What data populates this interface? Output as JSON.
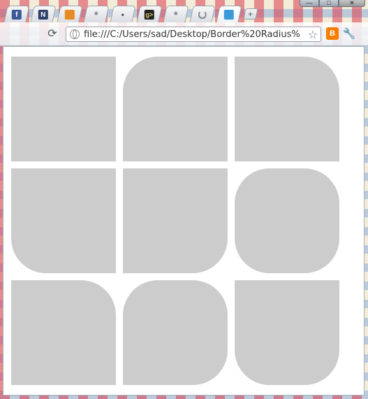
{
  "browser": {
    "address_bar": {
      "url": "file:///C:/Users/sad/Desktop/Border%20Radius%"
    },
    "tabs": [
      {
        "icon": "facebook-icon",
        "glyph": "f"
      },
      {
        "icon": "notepad-icon",
        "glyph": "N"
      },
      {
        "icon": "image-icon",
        "glyph": ""
      },
      {
        "icon": "asterisk-icon",
        "glyph": "*"
      },
      {
        "icon": "dot-icon",
        "glyph": "•"
      },
      {
        "icon": "terminal-icon",
        "glyph": "g>"
      },
      {
        "icon": "asterisk-icon",
        "glyph": "*"
      },
      {
        "icon": "loading-icon",
        "glyph": ""
      },
      {
        "icon": "ask-icon",
        "glyph": ""
      }
    ],
    "new_tab_glyph": "+",
    "window_controls": {
      "minimize": "—",
      "maximize": "□",
      "close": "✕"
    },
    "toolbar": {
      "reload_glyph": "⟳",
      "star_glyph": "☆",
      "blogger_glyph": "B",
      "wrench_glyph": "🔧"
    }
  },
  "content": {
    "background": "#ffffff",
    "box_color": "#cccccc",
    "boxes": [
      {
        "name": "no-radius"
      },
      {
        "name": "top-left-radius"
      },
      {
        "name": "top-right-radius"
      },
      {
        "name": "bottom-left-radius"
      },
      {
        "name": "bottom-right-radius"
      },
      {
        "name": "all-corners-radius"
      },
      {
        "name": "top-right-radius-row3"
      },
      {
        "name": "three-corners-radius"
      },
      {
        "name": "bottom-corners-radius"
      }
    ]
  }
}
